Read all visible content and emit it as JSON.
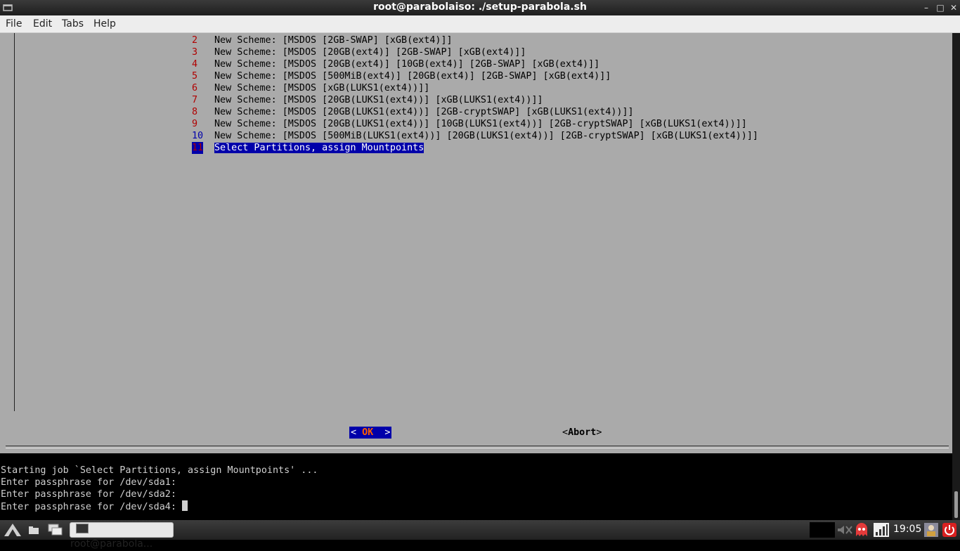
{
  "window": {
    "title": "root@parabolaiso: ./setup-parabola.sh",
    "controls": [
      "–",
      "□",
      "✕"
    ]
  },
  "menu": [
    "File",
    "Edit",
    "Tabs",
    "Help"
  ],
  "dialog": {
    "items": [
      {
        "num": "2",
        "text": "New Scheme: [MSDOS [2GB-SWAP] [xGB(ext4)]]"
      },
      {
        "num": "3",
        "text": "New Scheme: [MSDOS [20GB(ext4)] [2GB-SWAP] [xGB(ext4)]]"
      },
      {
        "num": "4",
        "text": "New Scheme: [MSDOS [20GB(ext4)] [10GB(ext4)] [2GB-SWAP] [xGB(ext4)]]"
      },
      {
        "num": "5",
        "text": "New Scheme: [MSDOS [500MiB(ext4)] [20GB(ext4)] [2GB-SWAP] [xGB(ext4)]]"
      },
      {
        "num": "6",
        "text": "New Scheme: [MSDOS [xGB(LUKS1(ext4))]]"
      },
      {
        "num": "7",
        "text": "New Scheme: [MSDOS [20GB(LUKS1(ext4))] [xGB(LUKS1(ext4))]]"
      },
      {
        "num": "8",
        "text": "New Scheme: [MSDOS [20GB(LUKS1(ext4))] [2GB-cryptSWAP] [xGB(LUKS1(ext4))]]"
      },
      {
        "num": "9",
        "text": "New Scheme: [MSDOS [20GB(LUKS1(ext4))] [10GB(LUKS1(ext4))] [2GB-cryptSWAP] [xGB(LUKS1(ext4))]]"
      },
      {
        "num": "10",
        "text": "New Scheme: [MSDOS [500MiB(LUKS1(ext4))] [20GB(LUKS1(ext4))] [2GB-cryptSWAP] [xGB(LUKS1(ext4))]]"
      }
    ],
    "selected": {
      "num": "11",
      "text": "Select Partitions, assign Mountpoints"
    },
    "ok_left": "< ",
    "ok_key": "OK",
    "ok_right": "  >",
    "abort_left": "<",
    "abort_label": "Abort",
    "abort_right": ">"
  },
  "output": [
    "Starting job `Select Partitions, assign Mountpoints' ...",
    "Enter passphrase for /dev/sda1:",
    "Enter passphrase for /dev/sda2:",
    "Enter passphrase for /dev/sda4: "
  ],
  "taskbar": {
    "task_label": "root@parabola...",
    "clock": "19:05"
  }
}
